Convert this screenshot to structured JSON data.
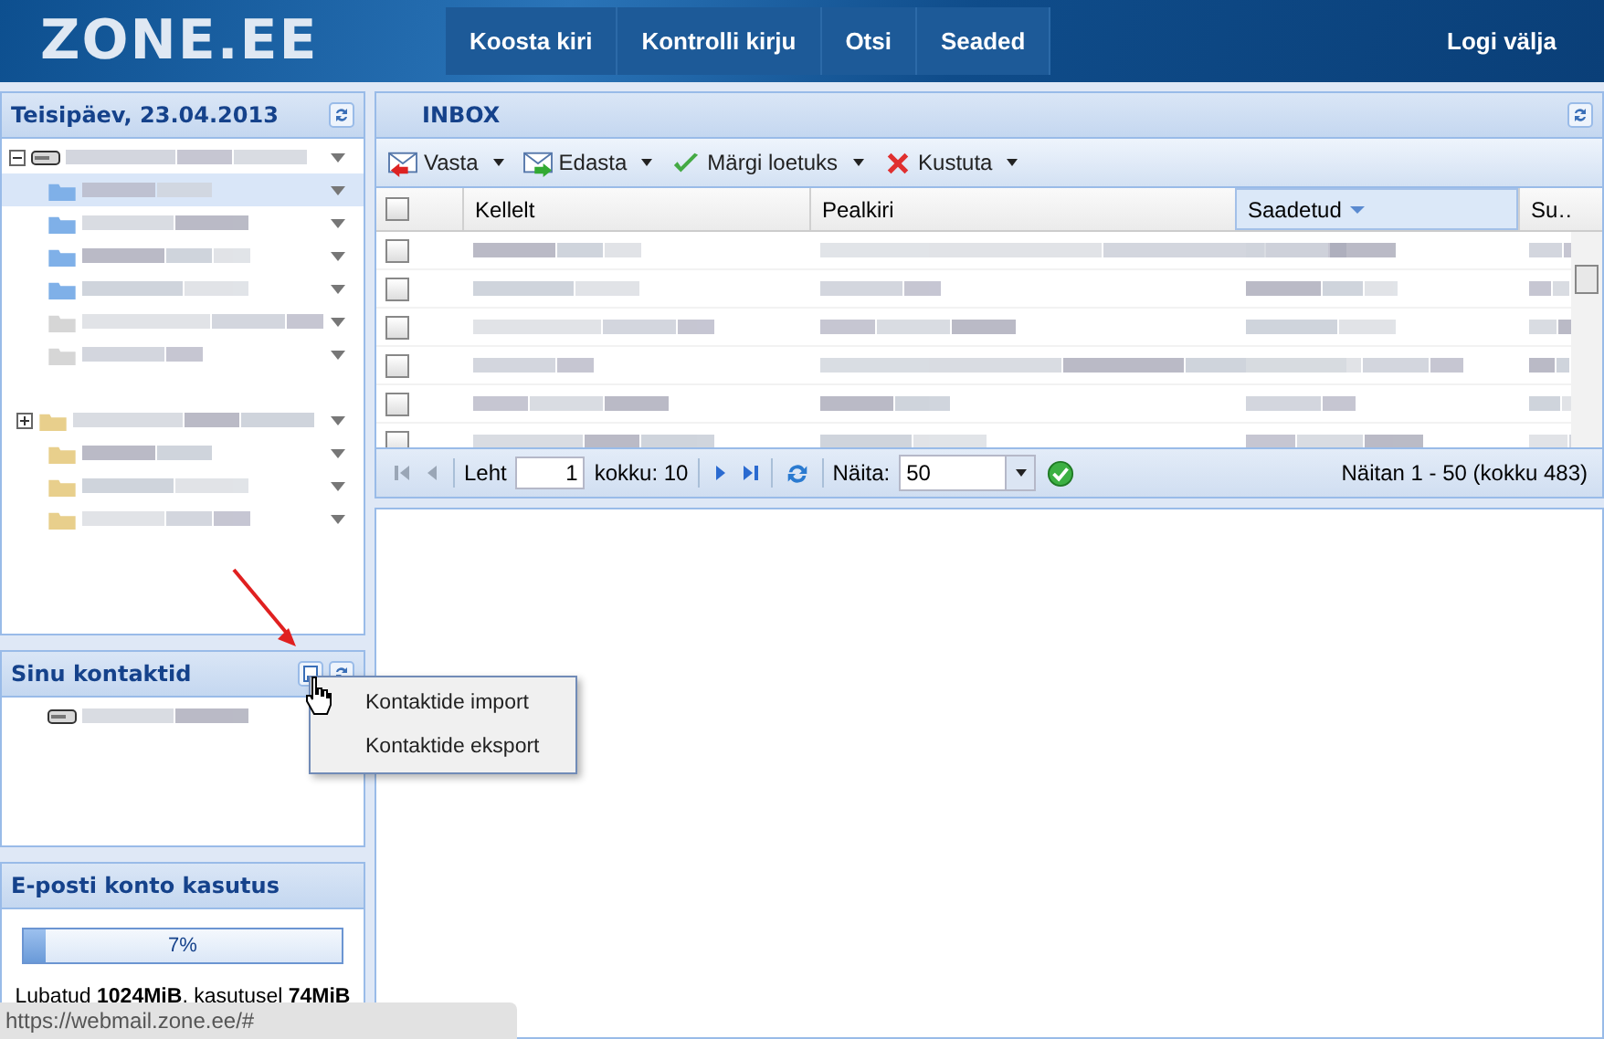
{
  "header": {
    "logo": "ZONE.EE",
    "nav": [
      {
        "label": "Koosta kiri"
      },
      {
        "label": "Kontrolli kirju"
      },
      {
        "label": "Otsi"
      },
      {
        "label": "Seaded"
      }
    ],
    "logout": "Logi välja"
  },
  "folders_panel": {
    "title": "Teisipäev, 23.04.2013",
    "tree": [
      {
        "kind": "account",
        "expanded": true,
        "selected": false,
        "children": [
          {
            "kind": "inbox",
            "selected": true
          },
          {
            "kind": "inbox",
            "selected": false
          },
          {
            "kind": "inbox",
            "selected": false
          },
          {
            "kind": "inbox",
            "selected": false
          },
          {
            "kind": "plain",
            "selected": false
          },
          {
            "kind": "plain",
            "selected": false
          },
          {
            "kind": "gap"
          },
          {
            "kind": "folder",
            "expanded": false,
            "selected": false
          },
          {
            "kind": "folder",
            "selected": false
          },
          {
            "kind": "folder",
            "selected": false
          },
          {
            "kind": "folder",
            "selected": false
          }
        ]
      }
    ]
  },
  "contacts_panel": {
    "title": "Sinu kontaktid",
    "tree": [
      {
        "kind": "account"
      }
    ],
    "menu": [
      {
        "label": "Kontaktide import"
      },
      {
        "label": "Kontaktide eksport"
      }
    ]
  },
  "usage_panel": {
    "title": "E-posti konto kasutus",
    "level": 0.07,
    "reading": "7%",
    "summary": "Lubatud **1024MiB**, kasutusel **74MiB**"
  },
  "inbox": {
    "title": "INBOX",
    "toolbar": [
      {
        "kind": "reply",
        "label": "Vasta"
      },
      {
        "kind": "forward",
        "label": "Edasta"
      },
      {
        "kind": "read",
        "label": "Märgi loetuks"
      },
      {
        "kind": "delete",
        "label": "Kustuta"
      }
    ],
    "select_all": {
      "checked": false
    },
    "columns": [
      {
        "label": "Kellelt",
        "sorted": false
      },
      {
        "label": "Pealkiri",
        "sorted": false
      },
      {
        "label": "Saadetud",
        "sorted": true
      },
      {
        "label": "Su…",
        "sorted": false
      }
    ],
    "rows": [
      {
        "checked": false
      },
      {
        "checked": false
      },
      {
        "checked": false
      },
      {
        "checked": false
      },
      {
        "checked": false
      },
      {
        "checked": false
      }
    ],
    "pager": {
      "page_label": "Leht",
      "page": "1",
      "total": "kokku: 10",
      "show_label": "Näita:",
      "page_size": "50",
      "summary": "Näitan 1 - 50 (kokku 483)"
    }
  },
  "status_bar": "https://webmail.zone.ee/#"
}
